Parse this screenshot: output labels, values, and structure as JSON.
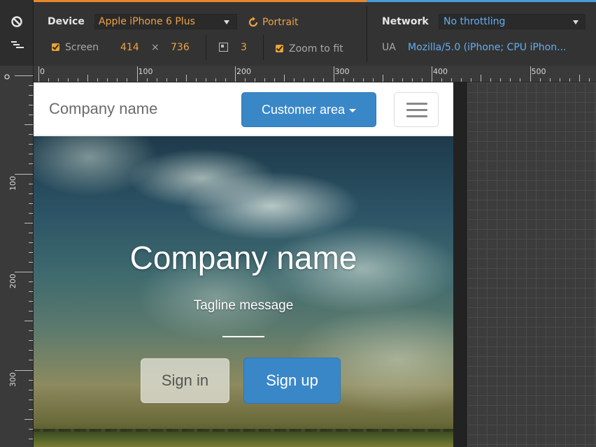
{
  "toolbar": {
    "device_label": "Device",
    "device_value": "Apple iPhone 6 Plus",
    "orientation_label": "Portrait",
    "screen_label": "Screen",
    "screen_width": "414",
    "screen_times": "×",
    "screen_height": "736",
    "pixel_ratio": "3",
    "zoom_label": "Zoom to fit",
    "network_label": "Network",
    "network_value": "No throttling",
    "ua_label": "UA",
    "ua_value": "Mozilla/5.0 (iPhone; CPU iPhon..."
  },
  "ruler_top": [
    "0",
    "100",
    "200",
    "300",
    "400",
    "500"
  ],
  "ruler_left": [
    "100",
    "200",
    "300"
  ],
  "page": {
    "navbar": {
      "brand": "Company name",
      "customer_area_label": "Customer area"
    },
    "hero": {
      "title": "Company name",
      "tagline": "Tagline message",
      "signin_label": "Sign in",
      "signup_label": "Sign up"
    }
  },
  "colors": {
    "accent_orange": "#e8872b",
    "accent_blue": "#4a9bd8",
    "primary_button": "#3a87c8"
  },
  "icons": [
    "disable-icon",
    "layout-icon",
    "dropdown-caret-icon",
    "rotate-icon",
    "pixel-ratio-icon",
    "hamburger-icon"
  ]
}
